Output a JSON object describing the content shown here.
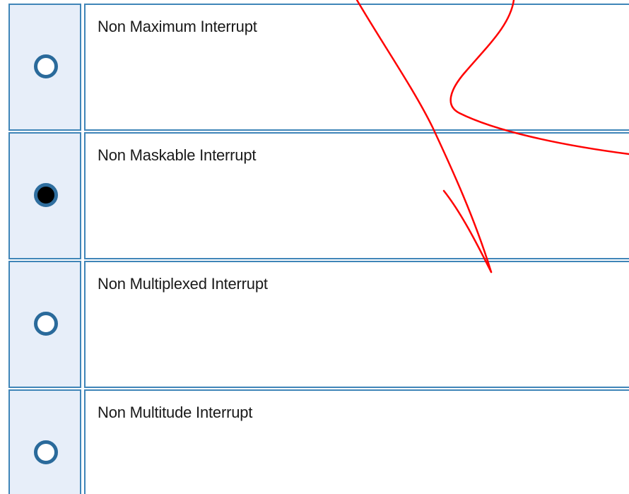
{
  "question": {
    "options": [
      {
        "label": "Non Maximum Interrupt",
        "selected": false
      },
      {
        "label": "Non Maskable Interrupt",
        "selected": true
      },
      {
        "label": "Non Multiplexed Interrupt",
        "selected": false
      },
      {
        "label": "Non Multitude Interrupt",
        "selected": false
      }
    ]
  },
  "colors": {
    "border": "#3f85b8",
    "radio_cell_bg": "#e7eef9",
    "radio_ring": "#2a6a9b",
    "annotation_ink": "#ff0000"
  }
}
